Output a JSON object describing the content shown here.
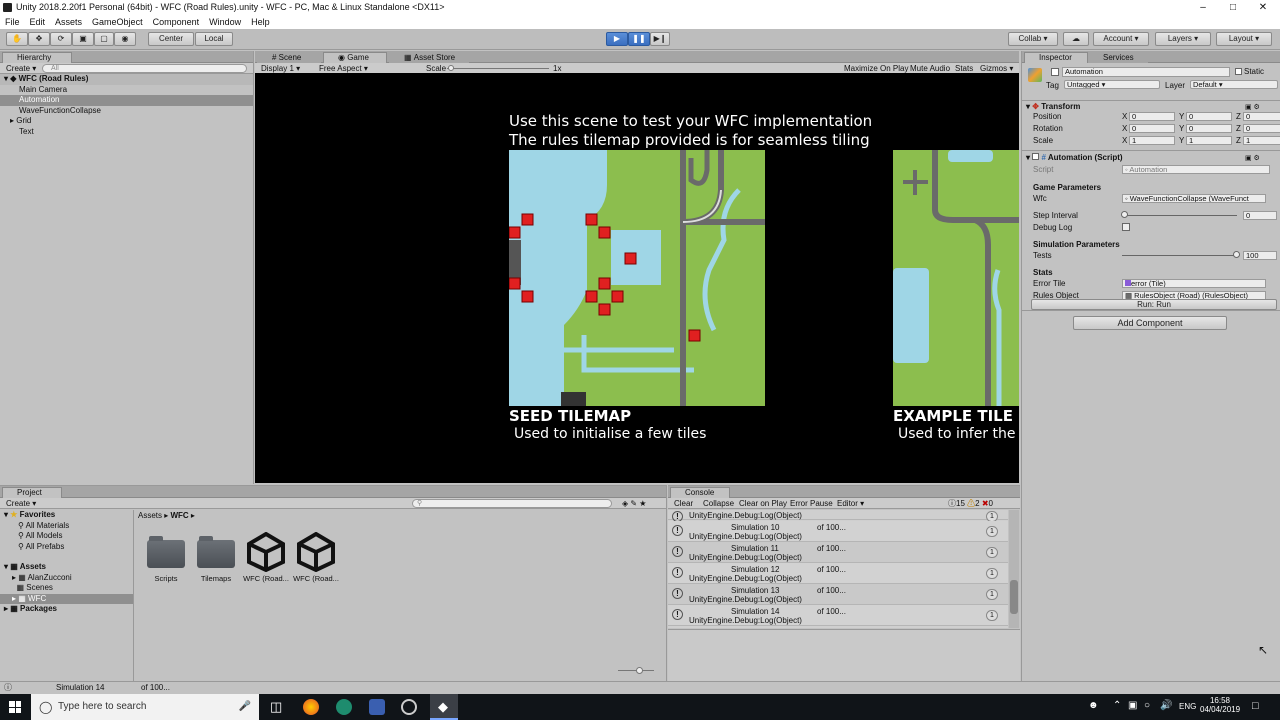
{
  "window": {
    "title": "Unity 2018.2.20f1 Personal (64bit) - WFC (Road Rules).unity - WFC - PC, Mac & Linux Standalone <DX11>"
  },
  "menu": [
    "File",
    "Edit",
    "Assets",
    "GameObject",
    "Component",
    "Window",
    "Help"
  ],
  "toolbar": {
    "center": "Center",
    "local": "Local",
    "collab": "Collab",
    "account": "Account",
    "layers": "Layers",
    "layout": "Layout"
  },
  "hierarchy": {
    "tab": "Hierarchy",
    "create": "Create",
    "search_placeholder": "All",
    "scene": "WFC (Road Rules)",
    "items": [
      {
        "label": "Main Camera",
        "indent": 1,
        "selected": false
      },
      {
        "label": "Automation",
        "indent": 1,
        "selected": true
      },
      {
        "label": "WaveFunctionCollapse",
        "indent": 1,
        "selected": false
      },
      {
        "label": "Grid",
        "indent": 1,
        "selected": false,
        "expandable": true
      },
      {
        "label": "Text",
        "indent": 1,
        "selected": false
      }
    ]
  },
  "views": {
    "scene_tab": "Scene",
    "game_tab": "Game",
    "asset_store_tab": "Asset Store",
    "display": "Display 1",
    "aspect": "Free Aspect",
    "scale_label": "Scale",
    "scale_value": "1x",
    "maximize": "Maximize On Play",
    "mute": "Mute Audio",
    "stats": "Stats",
    "gizmos": "Gizmos"
  },
  "game": {
    "line1": "Use this scene to test your WFC implementation",
    "line2": "The rules tilemap provided is for seamless tiling",
    "seed_title": "SEED TILEMAP",
    "seed_sub": "Used to initialise a few tiles",
    "example_title": "EXAMPLE TILE",
    "example_sub": "Used to infer the",
    "colors": {
      "water": "#9fd6e6",
      "grass": "#8cbe4e",
      "road": "#6a6a6a",
      "error": "#e02020"
    }
  },
  "inspector": {
    "tab": "Inspector",
    "services_tab": "Services",
    "object_name": "Automation",
    "static": "Static",
    "tag_label": "Tag",
    "tag_value": "Untagged",
    "layer_label": "Layer",
    "layer_value": "Default",
    "transform": {
      "title": "Transform",
      "rows": [
        {
          "label": "Position",
          "x": "0",
          "y": "0",
          "z": "0"
        },
        {
          "label": "Rotation",
          "x": "0",
          "y": "0",
          "z": "0"
        },
        {
          "label": "Scale",
          "x": "1",
          "y": "1",
          "z": "1"
        }
      ]
    },
    "script": {
      "title": "Automation (Script)",
      "script_label": "Script",
      "script_value": "Automation",
      "game_params": "Game Parameters",
      "wfc_label": "Wfc",
      "wfc_value": "WaveFunctionCollapse (WaveFunct",
      "step_label": "Step Interval",
      "step_value": "0",
      "debug_label": "Debug Log",
      "sim_params": "Simulation Parameters",
      "tests_label": "Tests",
      "tests_value": "100",
      "tests_fraction": 1.0,
      "stats": "Stats",
      "error_label": "Error Tile",
      "error_value": "error (Tile)",
      "rules_label": "Rules Object",
      "rules_value": "RulesObject (Road) (RulesObject)",
      "run_button": "Run: Run"
    },
    "add_component": "Add Component"
  },
  "project": {
    "tab": "Project",
    "create": "Create",
    "favorites": "Favorites",
    "fav_items": [
      "All Materials",
      "All Models",
      "All Prefabs"
    ],
    "assets": "Assets",
    "asset_items": [
      "AlanZucconi",
      "Scenes",
      "WFC"
    ],
    "packages": "Packages",
    "breadcrumb": [
      "Assets",
      "WFC"
    ],
    "files": [
      {
        "label": "Scripts",
        "kind": "folder"
      },
      {
        "label": "Tilemaps",
        "kind": "folder"
      },
      {
        "label": "WFC (Road...",
        "kind": "unity"
      },
      {
        "label": "WFC (Road...",
        "kind": "unity"
      }
    ]
  },
  "console": {
    "tab": "Console",
    "buttons": [
      "Clear",
      "Collapse",
      "Clear on Play",
      "Error Pause",
      "Editor"
    ],
    "warn_count": "15",
    "err_count": "2",
    "info_count": "0",
    "rows": [
      {
        "title": "Simulation 10",
        "detail": "of 100...",
        "src": "UnityEngine.Debug:Log(Object)",
        "count": "1"
      },
      {
        "title": "Simulation 11",
        "detail": "of 100...",
        "src": "UnityEngine.Debug:Log(Object)",
        "count": "1"
      },
      {
        "title": "Simulation 12",
        "detail": "of 100...",
        "src": "UnityEngine.Debug:Log(Object)",
        "count": "1"
      },
      {
        "title": "Simulation 13",
        "detail": "of 100...",
        "src": "UnityEngine.Debug:Log(Object)",
        "count": "1"
      },
      {
        "title": "Simulation 14",
        "detail": "of 100...",
        "src": "UnityEngine.Debug:Log(Object)",
        "count": "1"
      }
    ],
    "top_src": "UnityEngine.Debug:Log(Object)"
  },
  "status": {
    "message": "Simulation 14",
    "detail": "of 100..."
  },
  "taskbar": {
    "search": "Type here to search",
    "lang": "ENG",
    "time": "16:58",
    "date": "04/04/2019"
  }
}
